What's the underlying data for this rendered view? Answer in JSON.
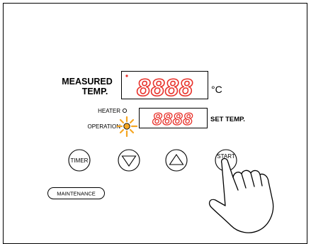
{
  "panel": {
    "measured_label_line1": "MEASURED",
    "measured_label_line2": "TEMP.",
    "measured_display": "8888",
    "measured_unit": "°C",
    "heater_label": "HEATER",
    "operation_label": "OPERATION",
    "set_display": "8888",
    "set_label": "SET TEMP.",
    "buttons": {
      "timer": "TIMER",
      "start": "START",
      "maintenance": "MAINTENANCE"
    },
    "icons": {
      "down": "triangle-down-icon",
      "up": "triangle-up-icon",
      "hand": "pointing-hand-icon",
      "lamp": "operation-lamp-lit-icon"
    },
    "colors": {
      "segment": "#e8312a",
      "lamp_glow": "#f5a623",
      "outline": "#000000"
    }
  }
}
